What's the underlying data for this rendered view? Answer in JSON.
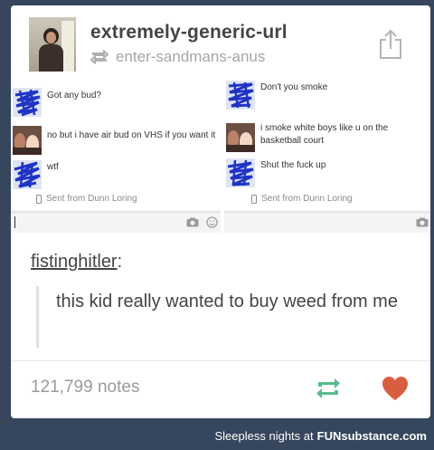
{
  "post": {
    "blog_name": "extremely-generic-url",
    "reblogged_from": "enter-sandmans-anus",
    "icons": {
      "share": "share-icon",
      "reblog_small": "reblog-icon",
      "avatar": "avatar-photo"
    }
  },
  "screenshot_left": {
    "messages": [
      {
        "text": "Got any bud?",
        "avatar": "scribbled-avatar"
      },
      {
        "text": "no but i have air bud on VHS if you want it",
        "avatar": "photo-avatar"
      },
      {
        "text": "wtf",
        "avatar": "scribbled-avatar"
      }
    ],
    "sent_from": "Sent from Dunn Loring"
  },
  "screenshot_right": {
    "messages": [
      {
        "text": "Don't you smoke",
        "avatar": "scribbled-avatar"
      },
      {
        "text": "i smoke white boys like u on the basketball court",
        "avatar": "photo-avatar"
      },
      {
        "text": "Shut the fuck up",
        "avatar": "scribbled-avatar"
      }
    ],
    "sent_from": "Sent from Dunn Loring"
  },
  "caption": {
    "username": "fistinghitler",
    "colon": ":",
    "quote": "this kid really wanted to buy weed from me"
  },
  "footer": {
    "notes": "121,799 notes",
    "colors": {
      "reblog": "#56bc8a",
      "like": "#d95e40"
    }
  },
  "watermark": {
    "text": "Sleepless nights at",
    "brand": "FUNsubstance.com"
  },
  "colors": {
    "background": "#36465d",
    "card": "#ffffff",
    "scribble": "#1f34c4"
  }
}
